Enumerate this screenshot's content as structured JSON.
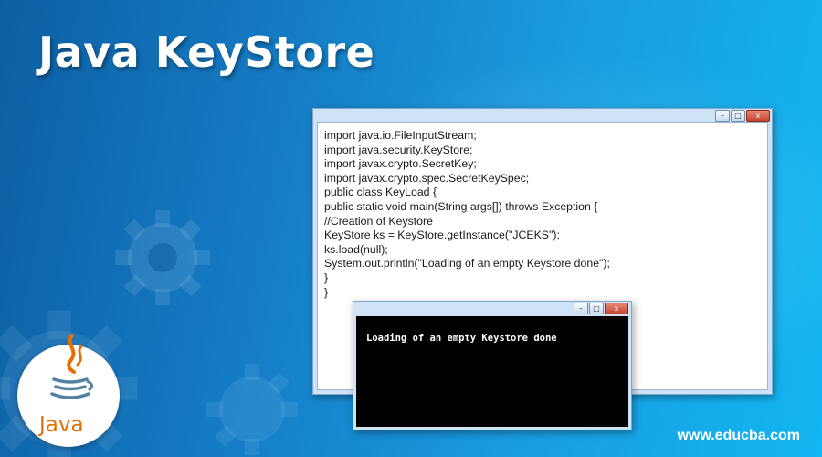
{
  "banner": {
    "title": "Java KeyStore",
    "site": "www.educba.com",
    "logo_text": "Java"
  },
  "editor_window": {
    "controls": {
      "minimize": "–",
      "maximize": "□",
      "close": "x"
    },
    "code_lines": [
      "import java.io.FileInputStream;",
      "import java.security.KeyStore;",
      "import javax.crypto.SecretKey;",
      "import javax.crypto.spec.SecretKeySpec;",
      "public class KeyLoad {",
      "public static void main(String args[]) throws Exception {",
      "//Creation of Keystore",
      "KeyStore ks = KeyStore.getInstance(\"JCEKS\");",
      "ks.load(null);",
      "System.out.println(\"Loading of an empty Keystore done\");",
      "}",
      "}"
    ]
  },
  "console_window": {
    "controls": {
      "minimize": "–",
      "maximize": "□",
      "close": "x"
    },
    "output": "Loading of an empty Keystore done"
  },
  "colors": {
    "background_start": "#0d5fa3",
    "background_end": "#12b6f2",
    "java_orange": "#e76f00",
    "java_blue": "#5382a1"
  }
}
